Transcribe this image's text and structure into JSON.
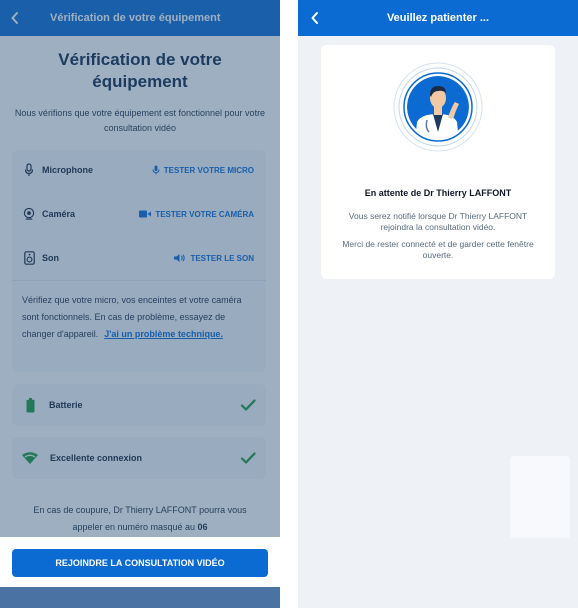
{
  "left_screen": {
    "header": {
      "title": "Vérification de votre équipement"
    },
    "title": "Vérification de votre équipement",
    "intro": "Nous vérifions que votre équipement est fonctionnel pour votre consultation vidéo",
    "equipment": [
      {
        "label": "Microphone",
        "icon": "microphone-icon",
        "test_label": "TESTER VOTRE MICRO",
        "test_icon": "microphone-icon"
      },
      {
        "label": "Caméra",
        "icon": "webcam-icon",
        "test_label": "TESTER VOTRE CAMÉRA",
        "test_icon": "video-camera-icon"
      },
      {
        "label": "Son",
        "icon": "speaker-icon",
        "test_label": "TESTER LE SON",
        "test_icon": "volume-icon"
      }
    ],
    "verify_text": "Vérifiez que votre micro, vos enceintes et votre caméra sont fonctionnels. En cas de problème, essayez de changer d'appareil.",
    "tech_problem_link": "J'ai un problème technique.",
    "status": [
      {
        "label": "Batterie",
        "icon": "battery-icon",
        "ok": true
      },
      {
        "label": "Excellente connexion",
        "icon": "wifi-icon",
        "ok": true
      }
    ],
    "coupure_text": "En cas de coupure, Dr Thierry LAFFONT pourra vous appeler en numéro masqué au",
    "coupure_number": "06",
    "join_button": "REJOINDRE LA CONSULTATION VIDÉO",
    "colors": {
      "primary": "#0b6bd3",
      "success": "#1a9a3c",
      "overlay": "#2c5078"
    }
  },
  "right_screen": {
    "header": {
      "title": "Veuillez patienter ..."
    },
    "waiting_title": "En attente de Dr Thierry LAFFONT",
    "notice": "Vous serez notifié lorsque Dr Thierry LAFFONT rejoindra la consultation vidéo.",
    "keep_connected": "Merci de rester connecté et de garder cette fenêtre ouverte.",
    "avatar_icon": "doctor-avatar-icon"
  }
}
